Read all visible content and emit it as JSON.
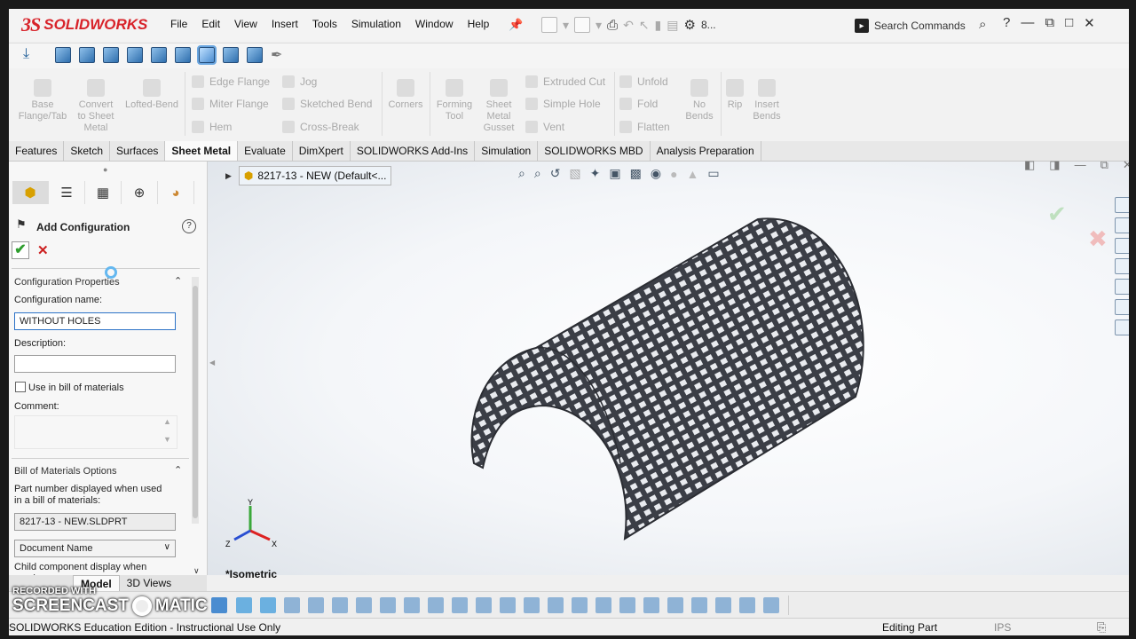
{
  "app": {
    "logo_ds": "3S",
    "logo_name": "SOLIDWORKS"
  },
  "menu": [
    "File",
    "Edit",
    "View",
    "Insert",
    "Tools",
    "Simulation",
    "Window",
    "Help"
  ],
  "quick": {
    "extra": "8...",
    "search_placeholder": "Search Commands"
  },
  "ribbon": {
    "big_buttons": [
      {
        "label": "Base\nFlange/Tab"
      },
      {
        "label": "Convert\nto Sheet\nMetal"
      },
      {
        "label": "Lofted-Bend"
      },
      {
        "label": "Corners"
      },
      {
        "label": "Forming\nTool"
      },
      {
        "label": "Sheet\nMetal\nGusset"
      },
      {
        "label": "No\nBends"
      },
      {
        "label": "Rip"
      },
      {
        "label": "Insert\nBends"
      }
    ],
    "col1": [
      "Edge Flange",
      "Miter Flange",
      "Hem"
    ],
    "col2": [
      "Jog",
      "Sketched Bend",
      "Cross-Break"
    ],
    "col3": [
      "Extruded Cut",
      "Simple Hole",
      "Vent"
    ],
    "col4": [
      "Unfold",
      "Fold",
      "Flatten"
    ]
  },
  "tabs": [
    "Features",
    "Sketch",
    "Surfaces",
    "Sheet Metal",
    "Evaluate",
    "DimXpert",
    "SOLIDWORKS Add-Ins",
    "Simulation",
    "SOLIDWORKS MBD",
    "Analysis Preparation"
  ],
  "active_tab": "Sheet Metal",
  "panel": {
    "title": "Add Configuration",
    "help": "?",
    "section1": "Configuration Properties",
    "config_name_label": "Configuration name:",
    "config_name_value": "WITHOUT HOLES",
    "description_label": "Description:",
    "description_value": "",
    "use_bom_label": "Use in bill of materials",
    "comment_label": "Comment:",
    "section2": "Bill of Materials Options",
    "part_number_label": "Part number displayed when used in a bill of materials:",
    "part_number_value": "8217-13 - NEW.SLDPRT",
    "dropdown_value": "Document Name",
    "child_label": "Child component display when used as a"
  },
  "viewport": {
    "breadcrumb": "8217-13 - NEW  (Default<...",
    "view_label": "*Isometric",
    "triad": {
      "x": "X",
      "y": "Y",
      "z": "Z"
    }
  },
  "bottom_tabs": [
    "Model",
    "3D Views"
  ],
  "active_bottom_tab": "Model",
  "status": {
    "left": "SOLIDWORKS Education Edition - Instructional Use Only",
    "mode": "Editing Part",
    "units": "IPS"
  },
  "watermark": {
    "line1": "RECORDED WITH",
    "line2": "SCREENCAST",
    "line3": "MATIC"
  },
  "colors": {
    "brand": "#d8232a",
    "accept": "#2e9d2e",
    "cancel": "#cc2020",
    "focus": "#2d73c7"
  }
}
